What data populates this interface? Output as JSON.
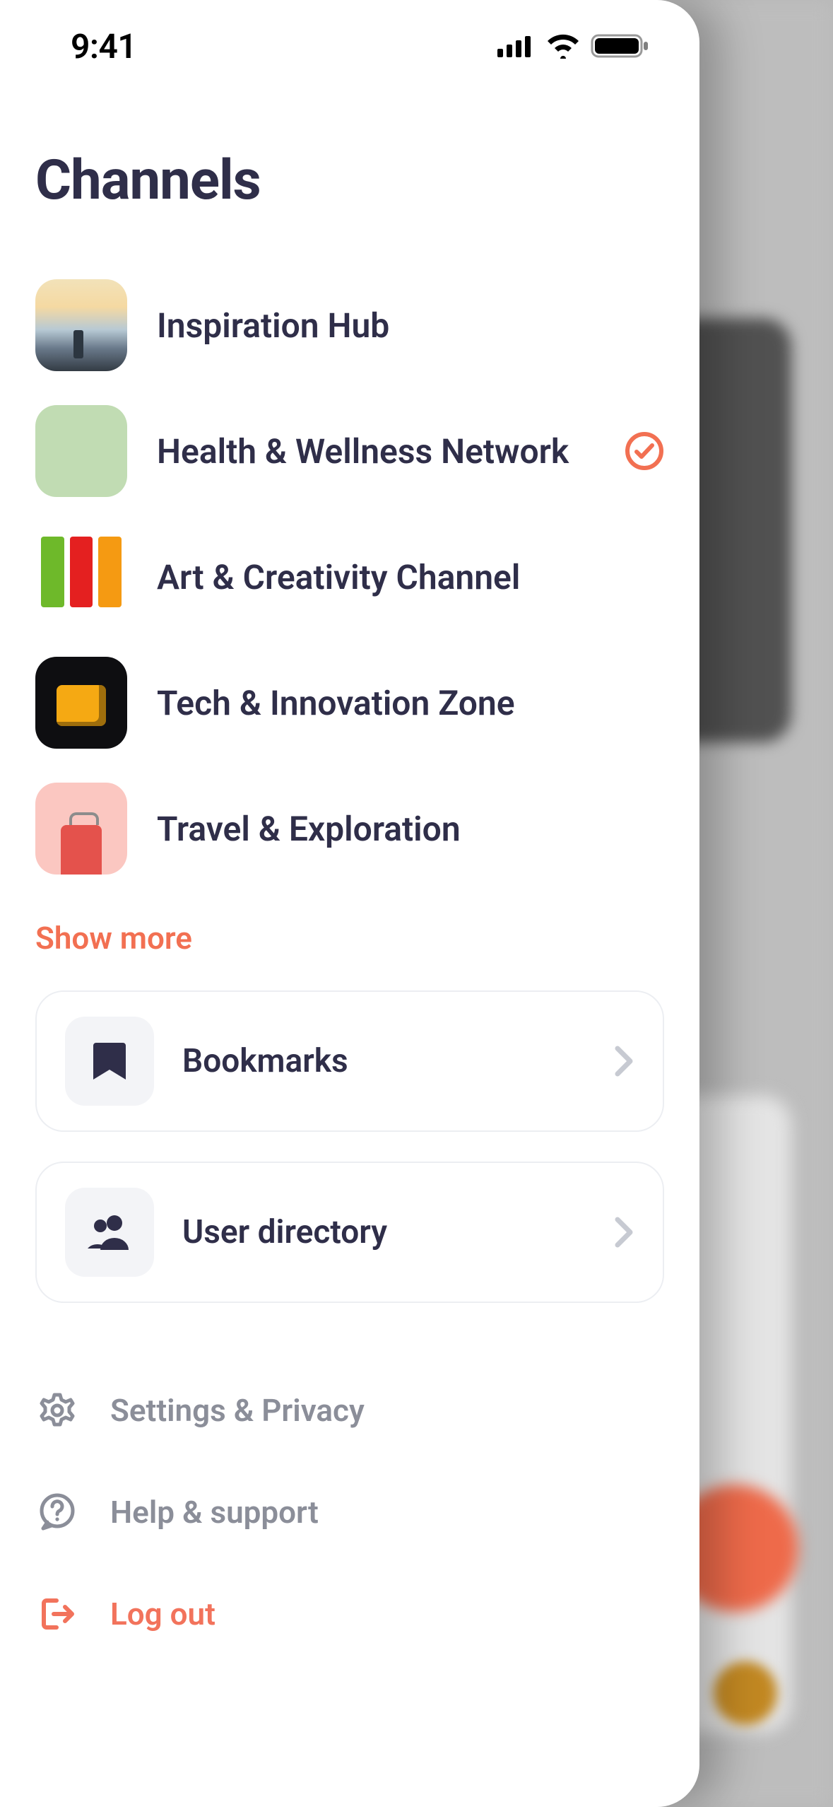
{
  "status": {
    "time": "9:41"
  },
  "title": "Channels",
  "channels": [
    {
      "label": "Inspiration Hub",
      "selected": false
    },
    {
      "label": "Health & Wellness Network",
      "selected": true
    },
    {
      "label": "Art & Creativity Channel",
      "selected": false
    },
    {
      "label": "Tech & Innovation Zone",
      "selected": false
    },
    {
      "label": "Travel & Exploration",
      "selected": false
    }
  ],
  "show_more_label": "Show more",
  "cards": {
    "bookmarks": "Bookmarks",
    "user_directory": "User directory"
  },
  "footer": {
    "settings": "Settings & Privacy",
    "help": "Help & support",
    "logout": "Log out"
  },
  "colors": {
    "accent": "#f27052",
    "text_primary": "#2f2e49",
    "text_secondary": "#8b8e99"
  }
}
